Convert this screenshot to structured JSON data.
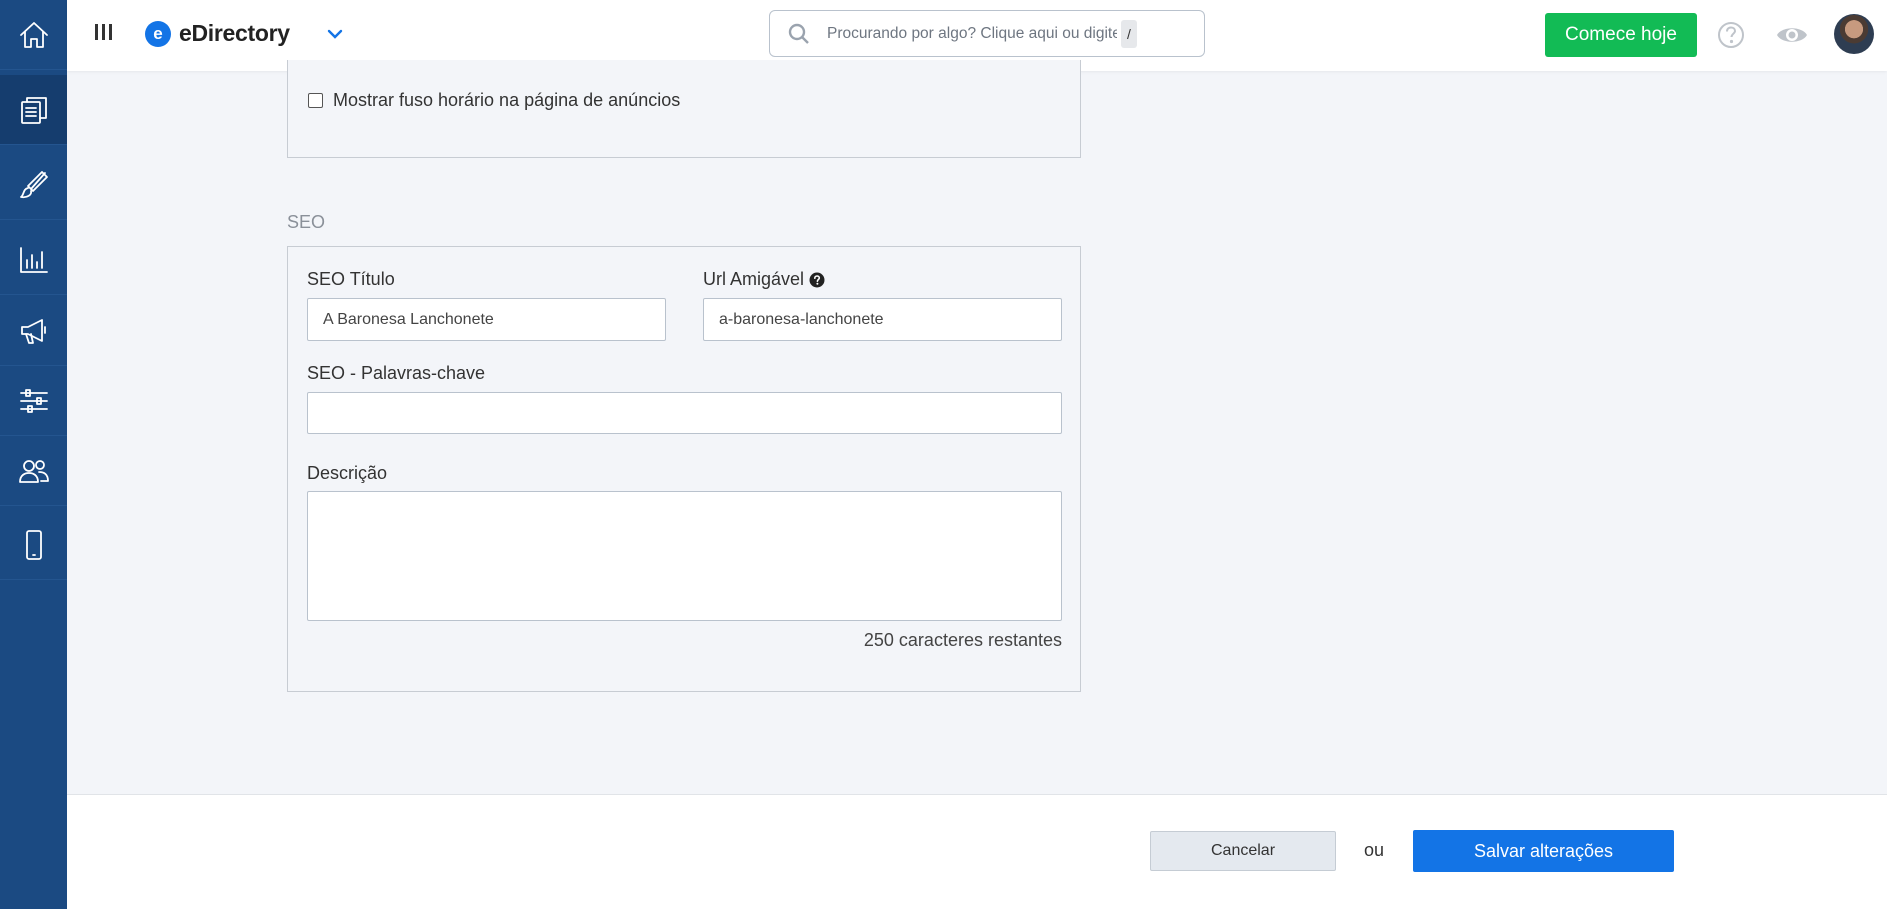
{
  "app": {
    "brand_name": "eDirectory",
    "brand_logo_letter": "e"
  },
  "sidebar": {
    "items": [
      {
        "icon": "home-icon"
      },
      {
        "icon": "content-icon",
        "active": true
      },
      {
        "icon": "brush-icon"
      },
      {
        "icon": "chart-icon"
      },
      {
        "icon": "megaphone-icon"
      },
      {
        "icon": "sliders-icon"
      },
      {
        "icon": "users-icon"
      },
      {
        "icon": "mobile-icon"
      }
    ]
  },
  "topbar": {
    "search_placeholder": "Procurando por algo? Clique aqui ou digite",
    "search_shortcut": "/",
    "cta_label": "Comece hoje"
  },
  "general": {
    "timezone_checkbox_label": "Mostrar fuso horário na página de anúncios",
    "timezone_checked": false
  },
  "seo": {
    "section_title": "SEO",
    "title_label": "SEO Título",
    "title_value": "A Baronesa Lanchonete",
    "url_label": "Url Amigável",
    "url_value": "a-baronesa-lanchonete",
    "keywords_label": "SEO - Palavras-chave",
    "keywords_value": "",
    "description_label": "Descrição",
    "description_value": "",
    "chars_remaining": "250 caracteres restantes"
  },
  "footer": {
    "cancel_label": "Cancelar",
    "or_label": "ou",
    "save_label": "Salvar alterações"
  },
  "colors": {
    "sidebar": "#1b4a82",
    "primary": "#1374e6",
    "success": "#12bb55",
    "background": "#f3f5f9"
  }
}
